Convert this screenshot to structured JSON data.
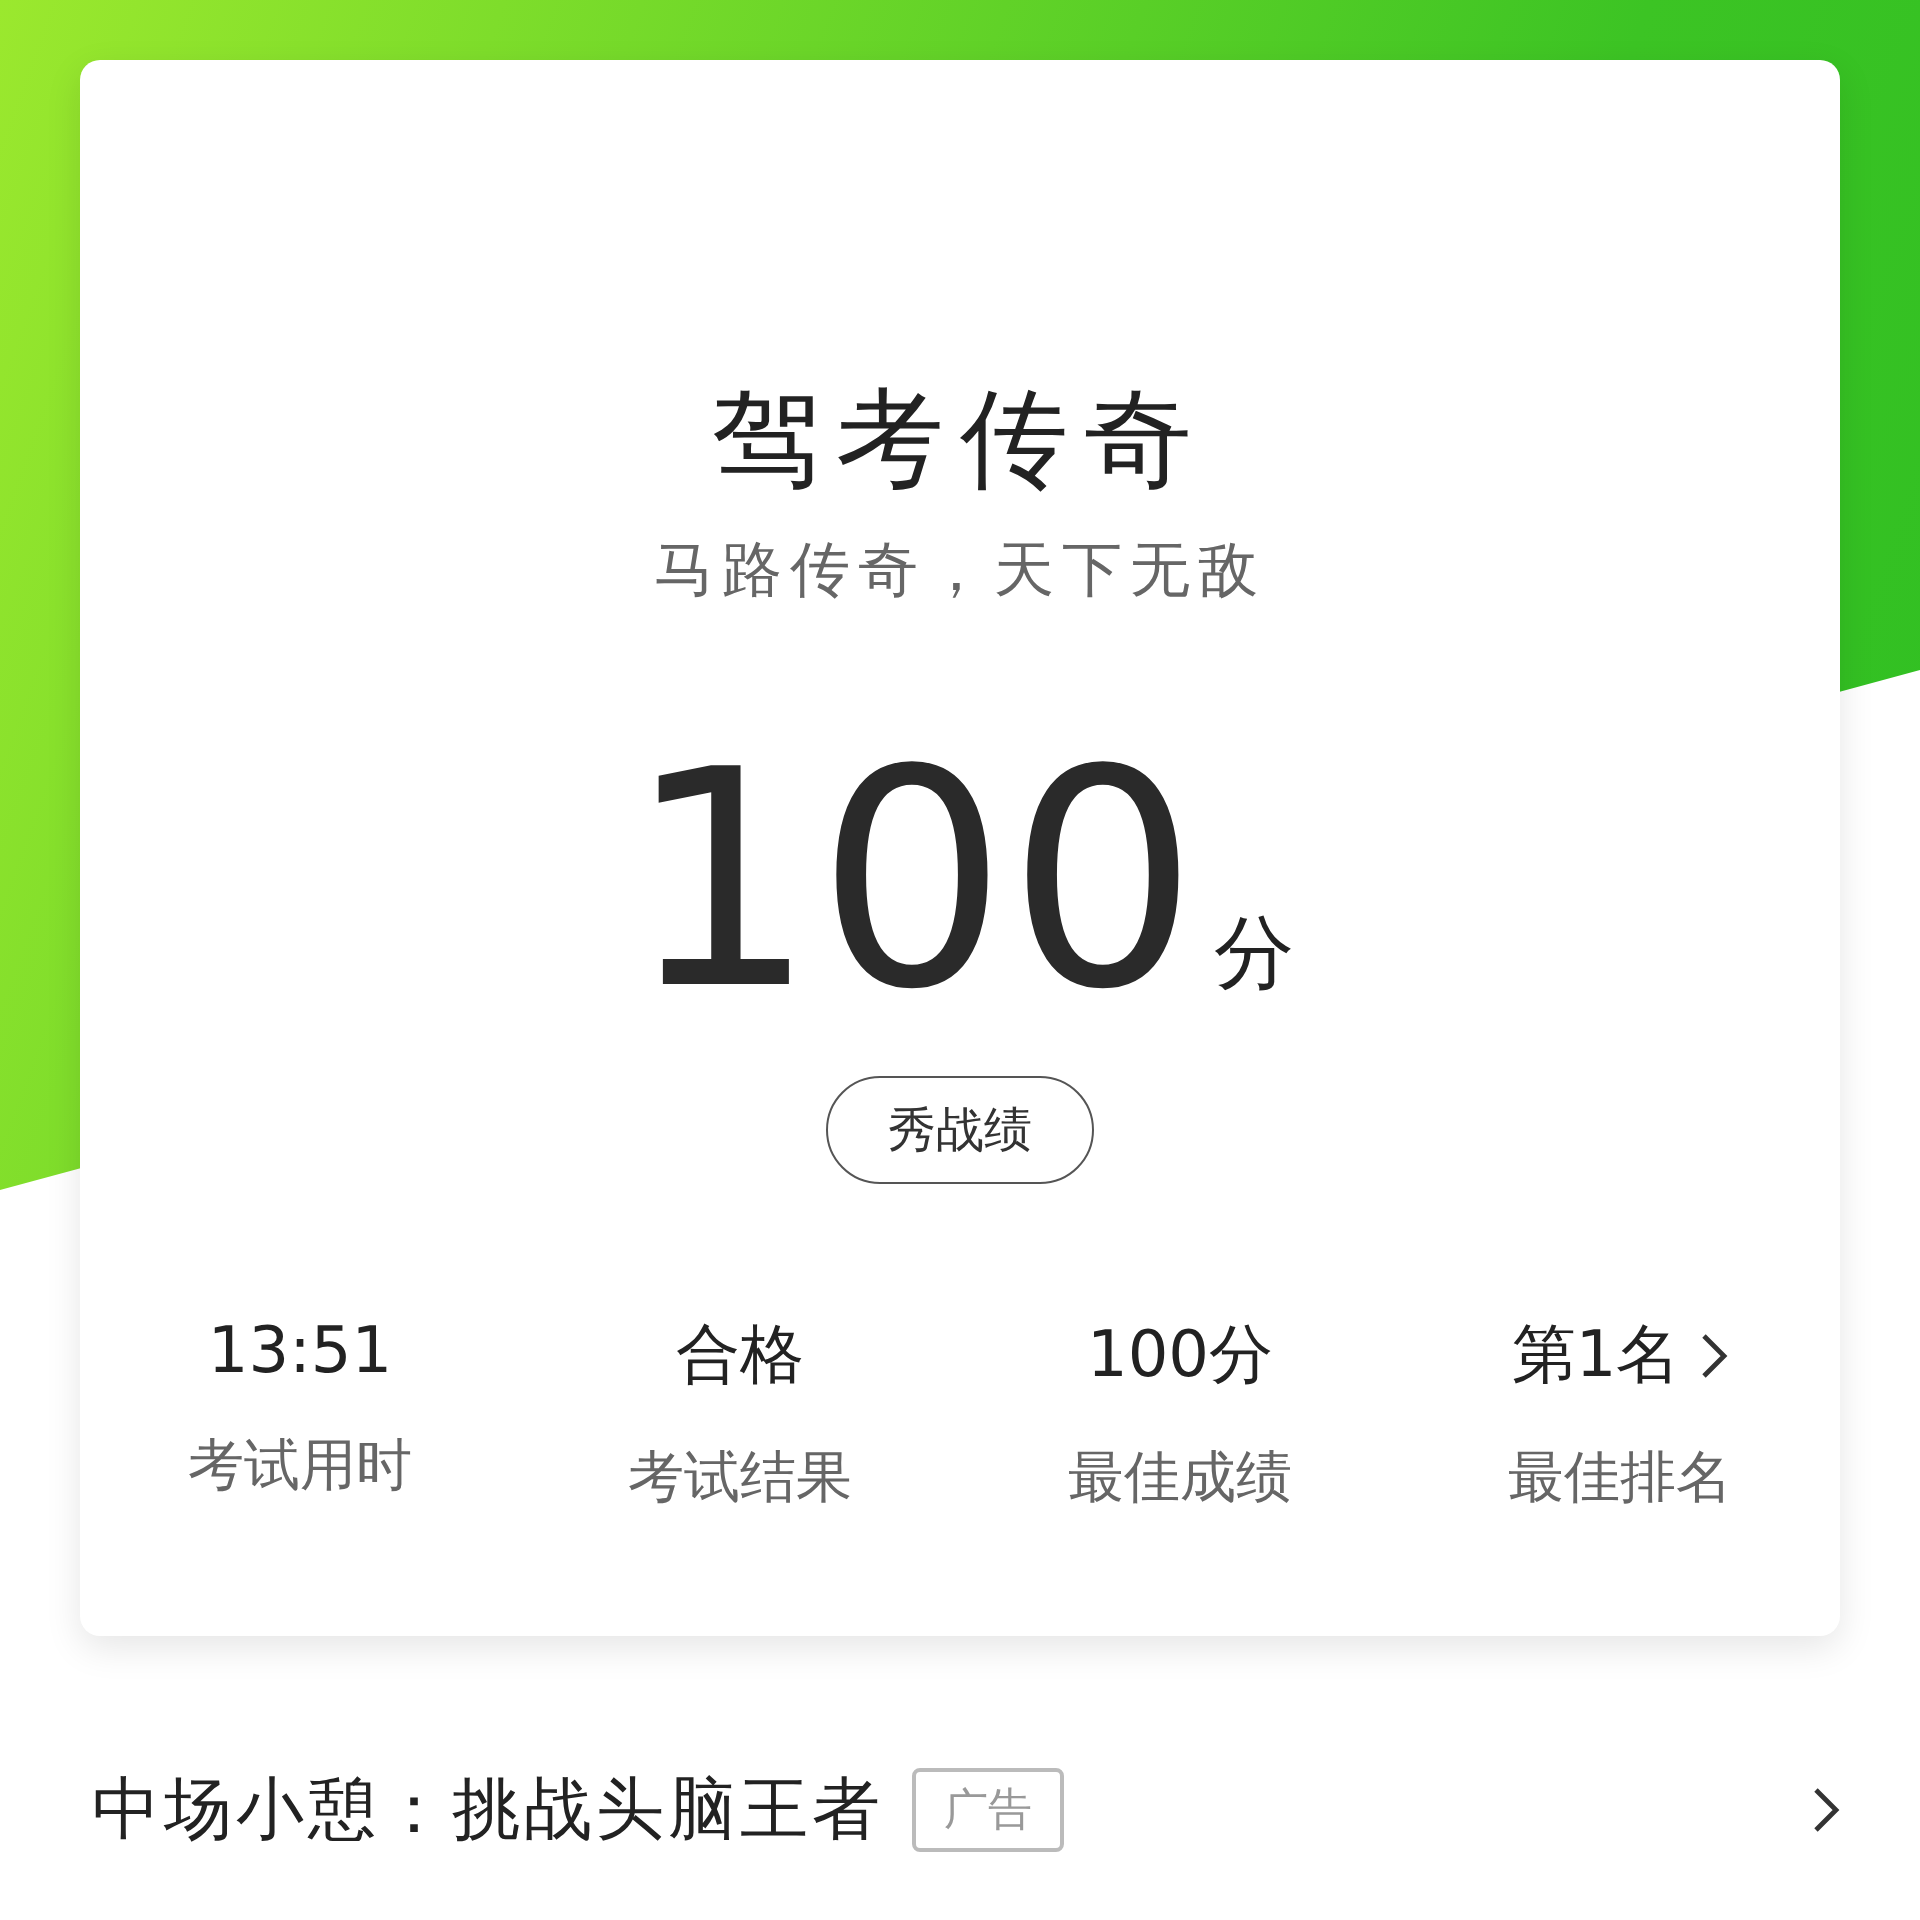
{
  "card": {
    "title": "驾考传奇",
    "subtitle": "马路传奇，天下无敌",
    "score": "100",
    "score_unit": "分",
    "share_button": "秀战绩",
    "stats": [
      {
        "value": "13:51",
        "label": "考试用时",
        "link": false
      },
      {
        "value": "合格",
        "label": "考试结果",
        "link": false
      },
      {
        "value": "100分",
        "label": "最佳成绩",
        "link": false
      },
      {
        "value": "第1名",
        "label": "最佳排名",
        "link": true
      }
    ]
  },
  "banner": {
    "text": "中场小憩：挑战头脑王者",
    "badge": "广告"
  }
}
